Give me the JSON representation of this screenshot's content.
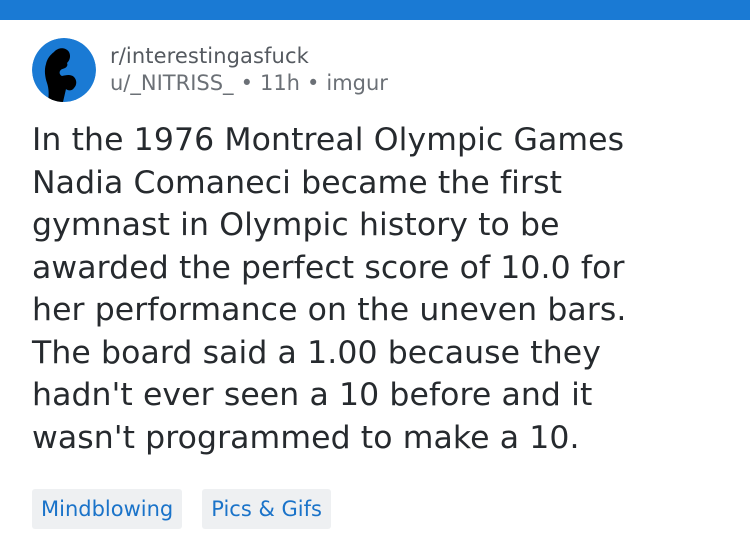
{
  "colors": {
    "top_bar": "#1a7ad4",
    "avatar_bg": "#1a7ad4",
    "title_text": "#262a2e",
    "meta_text": "#6b7076",
    "flair_bg": "#eef0f2",
    "flair_text": "#1a73c9"
  },
  "post": {
    "avatar_icon": "thinker-silhouette-icon",
    "subreddit": "r/interestingasfuck",
    "author": "u/_NITRISS_",
    "separator": "•",
    "age": "11h",
    "domain": "imgur",
    "title_lines": [
      "In the 1976 Montreal Olympic Games",
      "Nadia Comaneci became the first",
      "gymnast in Olympic history to be",
      "awarded the perfect score of 10.0 for",
      "her performance on the uneven bars.",
      "The board said a 1.00 because they",
      "hadn't ever seen a 10 before and it",
      "wasn't programmed to make a 10."
    ],
    "flairs": [
      "Mindblowing",
      "Pics & Gifs"
    ]
  }
}
